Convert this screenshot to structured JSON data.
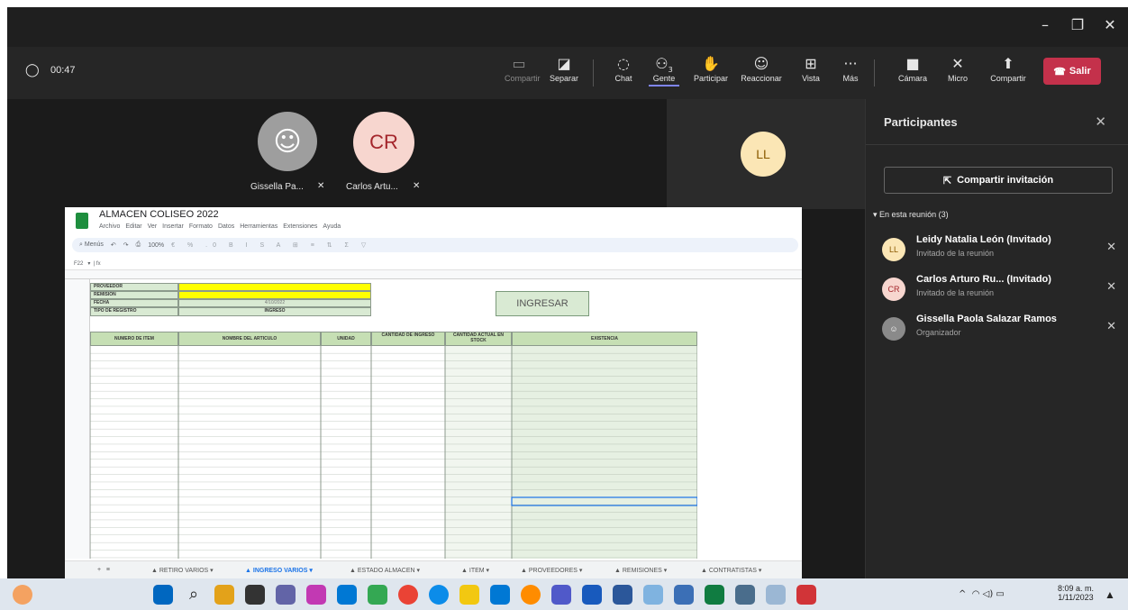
{
  "call": {
    "timer": "00:47",
    "toolbar": [
      {
        "label": "Compartir",
        "icon": "share-tray-icon"
      },
      {
        "label": "Separar",
        "icon": "popout-icon"
      },
      {
        "label": "Chat",
        "icon": "chat-icon"
      },
      {
        "label": "Gente",
        "icon": "people-icon",
        "count": "3"
      },
      {
        "label": "Participar",
        "icon": "hand-icon"
      },
      {
        "label": "Reaccionar",
        "icon": "emoji-icon"
      },
      {
        "label": "Vista",
        "icon": "view-icon"
      },
      {
        "label": "Más",
        "icon": "more-icon"
      },
      {
        "label": "Cámara",
        "icon": "camera-off-icon"
      },
      {
        "label": "Micro",
        "icon": "mic-off-icon"
      },
      {
        "label": "Compartir",
        "icon": "share-icon"
      }
    ],
    "leave_label": "Salir"
  },
  "stage": {
    "tiles": [
      {
        "initials": "",
        "name": "Gissella Pa..."
      },
      {
        "initials": "CR",
        "name": "Carlos Artu..."
      },
      {
        "initials": "LL",
        "name": ""
      }
    ]
  },
  "panel": {
    "title": "Participantes",
    "invite_label": "Compartir invitación",
    "section": "En esta reunión (3)",
    "people": [
      {
        "initials": "LL",
        "name": "Leidy Natalia León (Invitado)",
        "role": "Invitado de la reunión"
      },
      {
        "initials": "CR",
        "name": "Carlos Arturo Ru... (Invitado)",
        "role": "Invitado de la reunión"
      },
      {
        "initials": "",
        "name": "Gissella Paola Salazar Ramos",
        "role": "Organizador"
      }
    ]
  },
  "sheet": {
    "title": "ALMACEN COLISEO 2022",
    "menu": [
      "Archivo",
      "Editar",
      "Ver",
      "Insertar",
      "Formato",
      "Datos",
      "Herramientas",
      "Extensiones",
      "Ayuda"
    ],
    "search": "Menús",
    "zoom": "100%",
    "cell_ref": "F22",
    "labels": [
      "PROVEEDOR",
      "REMISION",
      "FECHA",
      "TIPO DE REGISTRO"
    ],
    "fecha_value": "4/10/2022",
    "tipo_value": "INGRESO",
    "button": "INGRESAR",
    "columns": [
      "NUMERO DE ITEM",
      "NOMBRE DEL ARTICULO",
      "UNIDAD",
      "CANTIDAD DE INGRESO",
      "CANTIDAD ACTUAL EN STOCK",
      "EXISTENCIA"
    ],
    "tabs": [
      "RETIRO VARIOS",
      "INGRESO VARIOS",
      "ESTADO ALMACEN",
      "ITEM",
      "PROVEEDORES",
      "REMISIONES",
      "CONTRATISTAS"
    ]
  },
  "taskbar": {
    "time": "8:09 a. m.",
    "date": "1/11/2023"
  },
  "colors": {
    "leave": "#c4314b",
    "active_tab": "#1a73e8",
    "header_green": "#c6dfb4"
  }
}
